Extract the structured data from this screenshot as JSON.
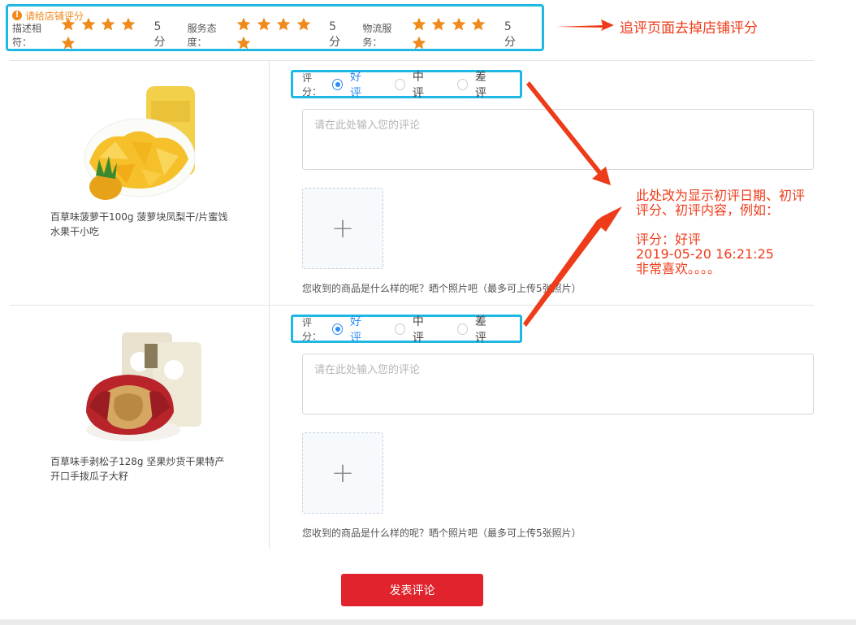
{
  "shop_rating": {
    "title": "请给店铺评分",
    "items": [
      {
        "label": "描述相符：",
        "stars": 5,
        "score": "5分"
      },
      {
        "label": "服务态度：",
        "stars": 5,
        "score": "5分"
      },
      {
        "label": "物流服务：",
        "stars": 5,
        "score": "5分"
      }
    ]
  },
  "annotations": {
    "top_note": "追评页面去掉店铺评分",
    "side_note": "此处改为显示初评日期、初评\n评分、初评内容，例如：\n\n评分：好评\n2019-05-20 16:21:25\n非常喜欢。。。。"
  },
  "colors": {
    "accent": "#2d8cf0",
    "star": "#f08a1c",
    "submit": "#e0232d",
    "highlight_border": "#1fb8e4",
    "annotation": "#ee3b1a"
  },
  "rating_label": "评分：",
  "rating_options": [
    "好评",
    "中评",
    "差评"
  ],
  "products": [
    {
      "name_line1": "百草味菠萝干100g 菠萝块凤梨干/片蜜饯",
      "name_line2": "水果干小吃",
      "selected": "好评",
      "comment_placeholder": "请在此处输入您的评论",
      "upload_hint": "您收到的商品是什么样的呢？晒个照片吧（最多可上传5张照片）"
    },
    {
      "name_line1": "百草味手剥松子128g 坚果炒货干果特产",
      "name_line2": "开口手拨瓜子大籽",
      "selected": "好评",
      "comment_placeholder": "请在此处输入您的评论",
      "upload_hint": "您收到的商品是什么样的呢？晒个照片吧（最多可上传5张照片）"
    }
  ],
  "submit_label": "发表评论"
}
